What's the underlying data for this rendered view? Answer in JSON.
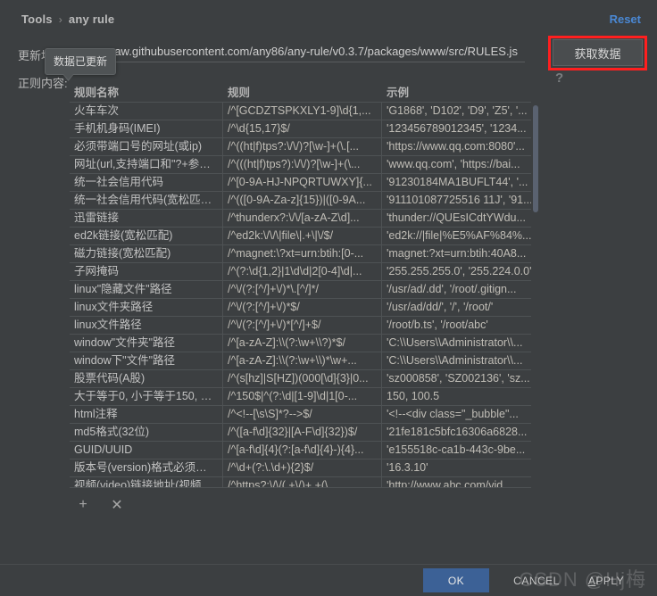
{
  "breadcrumb": {
    "root": "Tools",
    "separator": "›",
    "current": "any rule"
  },
  "header": {
    "reset_label": "Reset"
  },
  "update": {
    "label": "更新地",
    "url_value": "raw.githubusercontent.com/any86/any-rule/v0.3.7/packages/www/src/RULES.js",
    "url_placeholder": "",
    "fetch_label": "获取数据",
    "highlight_color": "#ff1f1f"
  },
  "tooltip": {
    "text": "数据已更新"
  },
  "content": {
    "label": "正则内容:",
    "help_icon": "?"
  },
  "table": {
    "columns": [
      "规则名称",
      "规则",
      "示例"
    ],
    "rows": [
      [
        "火车车次",
        "/^[GCDZTSPKXLY1-9]\\d{1,...",
        "'G1868', 'D102', 'D9', 'Z5', '..."
      ],
      [
        "手机机身码(IMEI)",
        "/^\\d{15,17}$/",
        "'123456789012345', '1234..."
      ],
      [
        "必须带端口号的网址(或ip)",
        "/^((ht|f)tps?:\\/\\/)?[\\w-]+(\\.[...",
        "'https://www.qq.com:8080'..."
      ],
      [
        "网址(url,支持端口和\"?+参数\"...",
        "/^(((ht|f)tps?):\\/\\/)?[\\w-]+(\\...",
        "'www.qq.com', 'https://bai..."
      ],
      [
        "统一社会信用代码",
        "/^[0-9A-HJ-NPQRTUWXY]{...",
        "'91230184MA1BUFLT44', '..."
      ],
      [
        "统一社会信用代码(宽松匹配)...",
        "/^(([0-9A-Za-z]{15})|([0-9A...",
        "'911101087725516 11J', '91..."
      ],
      [
        "迅雷链接",
        "/^thunderx?:\\/\\/[a-zA-Z\\d]...",
        "'thunder://QUEsICdtYWdu..."
      ],
      [
        "ed2k链接(宽松匹配)",
        "/^ed2k:\\/\\/\\|file\\|.+\\|\\/$/",
        "'ed2k://|file|%E5%AF%84%..."
      ],
      [
        "磁力链接(宽松匹配)",
        "/^magnet:\\?xt=urn:btih:[0-...",
        "'magnet:?xt=urn:btih:40A8..."
      ],
      [
        "子网掩码",
        "/^(?:\\d{1,2}|1\\d\\d|2[0-4]\\d|...",
        "'255.255.255.0', '255.224.0.0'"
      ],
      [
        "linux\"隐藏文件\"路径",
        "/^\\/(?:[^/]+\\/)*\\.[^/]*/",
        "'/usr/ad/.dd', '/root/.gitign..."
      ],
      [
        "linux文件夹路径",
        "/^\\/(?:[^/]+\\/)*$/",
        "'/usr/ad/dd/', '/', '/root/'"
      ],
      [
        "linux文件路径",
        "/^\\/(?:[^/]+\\/)*[^/]+$/",
        "'/root/b.ts', '/root/abc'"
      ],
      [
        "window\"文件夹\"路径",
        "/^[a-zA-Z]:\\\\(?:\\w+\\\\?)*$/",
        "'C:\\\\Users\\\\Administrator\\\\..."
      ],
      [
        "window下\"文件\"路径",
        "/^[a-zA-Z]:\\\\(?:\\w+\\\\)*\\w+...",
        "'C:\\\\Users\\\\Administrator\\\\..."
      ],
      [
        "股票代码(A股)",
        "/^(s[hz]|S[HZ])(000[\\d]{3}|0...",
        "'sz000858', 'SZ002136', 'sz..."
      ],
      [
        "大于等于0, 小于等于150, 支...",
        "/^150$|^(?:\\d|[1-9]\\d|1[0-...",
        "150, 100.5"
      ],
      [
        "html注释",
        "/^<!--[\\s\\S]*?-->$/",
        "'<!--<div class=\"_bubble\"..."
      ],
      [
        "md5格式(32位)",
        "/^([a-f\\d]{32}|[A-F\\d]{32})$/",
        "'21fe181c5bfc16306a6828..."
      ],
      [
        "GUID/UUID",
        "/^[a-f\\d]{4}(?:[a-f\\d]{4}-){4}...",
        "'e155518c-ca1b-443c-9be..."
      ],
      [
        "版本号(version)格式必须为X...",
        "/^\\d+(?:\\.\\d+){2}$/",
        "'16.3.10'"
      ],
      [
        "视频(video)链接地址(视频",
        "/^https?:\\/\\/(.+\\/)+.+(\\....",
        "'http://www.abc.com/vid..."
      ]
    ]
  },
  "row_toolbar": {
    "add_icon": "+",
    "remove_icon": "✕"
  },
  "footer": {
    "ok_label": "OK",
    "cancel_label": "CANCEL",
    "apply_label_underline": "A",
    "apply_label_rest": "PPLY"
  },
  "watermark": {
    "text": "CSDN @Hj梅"
  }
}
